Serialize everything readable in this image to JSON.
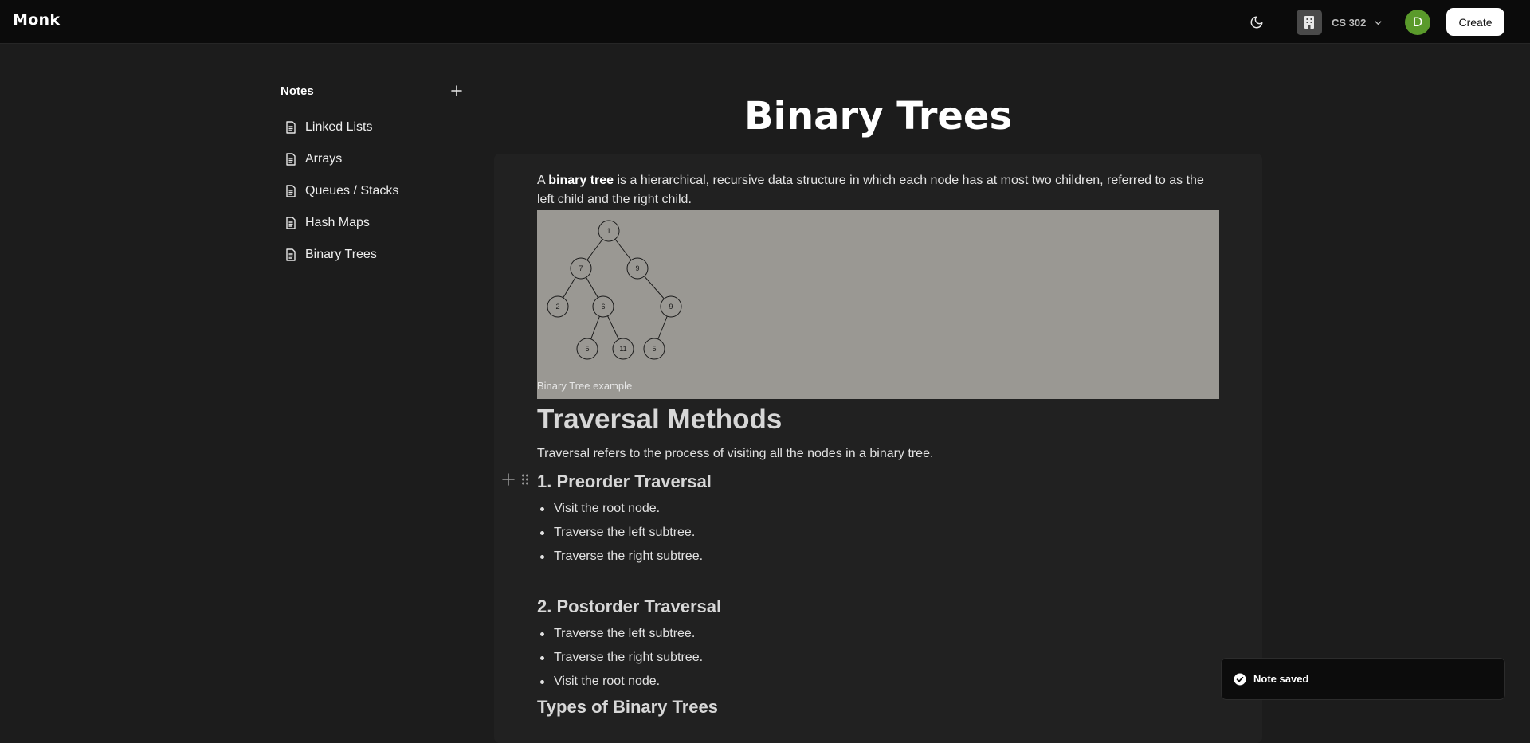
{
  "app": {
    "title": "Monk"
  },
  "header": {
    "theme_icon": "moon-icon",
    "workspace": {
      "name": "CS 302",
      "icon": "building-icon"
    },
    "avatar_letter": "D",
    "create_label": "Create"
  },
  "sidebar": {
    "title": "Notes",
    "items": [
      {
        "label": "Linked Lists",
        "icon": "file-text-icon"
      },
      {
        "label": "Arrays",
        "icon": "file-text-icon"
      },
      {
        "label": "Queues / Stacks",
        "icon": "file-text-icon"
      },
      {
        "label": "Hash Maps",
        "icon": "file-text-icon"
      },
      {
        "label": "Binary Trees",
        "icon": "file-text-icon"
      }
    ]
  },
  "note": {
    "title": "Binary Trees",
    "intro_prefix": "A ",
    "intro_bold": "binary tree",
    "intro_suffix": " is a hierarchical, recursive data structure in which each node has at most two children, referred to as the left child and the right child.",
    "figure": {
      "caption": "Binary Tree example",
      "nodes": [
        "1",
        "7",
        "9",
        "2",
        "6",
        "9",
        "5",
        "11",
        "5"
      ]
    },
    "section_heading": "Traversal Methods",
    "section_text": "Traversal refers to the process of visiting all the nodes in a binary tree.",
    "preorder": {
      "heading": "1. Preorder Traversal",
      "items": [
        "Visit the root node.",
        "Traverse the left subtree.",
        "Traverse the right subtree."
      ]
    },
    "postorder": {
      "heading": "2. Postorder Traversal",
      "items": [
        "Traverse the left subtree.",
        "Traverse the right subtree.",
        "Visit the root node."
      ]
    },
    "types_heading": "Types of Binary Trees"
  },
  "toast": {
    "message": "Note saved",
    "icon": "check-circle-icon"
  },
  "colors": {
    "avatar": "#5a9a2b",
    "figure_background": "#9a9893",
    "background": "#1c1c1c"
  }
}
